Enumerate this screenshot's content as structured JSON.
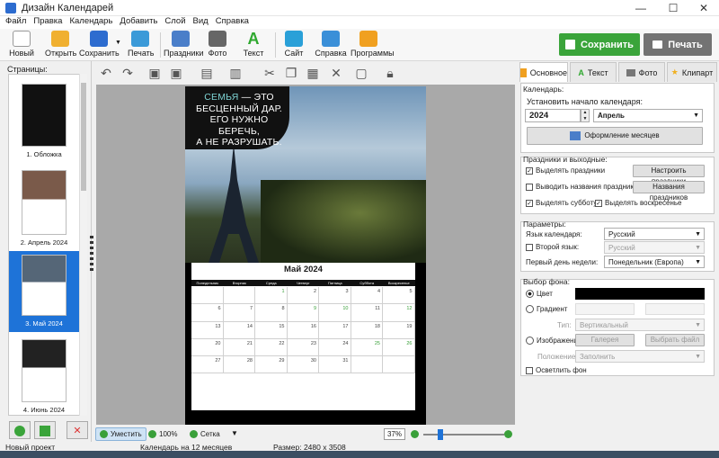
{
  "window": {
    "title": "Дизайн Календарей",
    "minimize": "—",
    "maximize": "☐",
    "close": "✕"
  },
  "menu": [
    "Файл",
    "Правка",
    "Календарь",
    "Добавить",
    "Слой",
    "Вид",
    "Справка"
  ],
  "toolbar": {
    "new": "Новый",
    "open": "Открыть",
    "save": "Сохранить",
    "print": "Печать",
    "holidays": "Праздники",
    "photo": "Фото",
    "text": "Текст",
    "site": "Сайт",
    "help": "Справка",
    "programs": "Программы",
    "save_big": "Сохранить",
    "print_big": "Печать",
    "colors": {
      "save_big": "#3aa43a",
      "print_big": "#737373"
    }
  },
  "left": {
    "header": "Страницы:",
    "thumbs": [
      {
        "label": "1. Обложка"
      },
      {
        "label": "2. Апрель 2024"
      },
      {
        "label": "3. Май 2024",
        "selected": true
      },
      {
        "label": "4. Июнь 2024"
      }
    ]
  },
  "page": {
    "quote_highlight": "СЕМЬЯ",
    "quote_line1": " — ЭТО",
    "quote_line2": "БЕСЦЕННЫЙ ДАР.",
    "quote_line3": "ЕГО НУЖНО БЕРЕЧЬ,",
    "quote_line4": "А НЕ РАЗРУШАТЬ.",
    "month_title": "Май 2024",
    "weekdays": [
      "Понедельник",
      "Вторник",
      "Среда",
      "Четверг",
      "Пятница",
      "Суббота",
      "Воскресенье"
    ],
    "weeks": [
      [
        "",
        "",
        "1",
        "2",
        "3",
        "4",
        "5"
      ],
      [
        "6",
        "7",
        "8",
        "9",
        "10",
        "11",
        "12"
      ],
      [
        "13",
        "14",
        "15",
        "16",
        "17",
        "18",
        "19"
      ],
      [
        "20",
        "21",
        "22",
        "23",
        "24",
        "25",
        "26"
      ],
      [
        "27",
        "28",
        "29",
        "30",
        "31",
        "",
        ""
      ]
    ],
    "green_days": [
      "1",
      "9",
      "10",
      "12",
      "25",
      "26"
    ]
  },
  "bottom": {
    "fit": "Уместить",
    "zoom100": "100%",
    "grid": "Сетка",
    "zoom": "37%"
  },
  "right": {
    "tabs": [
      "Основное",
      "Текст",
      "Фото",
      "Клипарт"
    ],
    "calendar_group": "Календарь:",
    "start_label": "Установить начало календаря:",
    "year": "2024",
    "month": "Апрель",
    "months_design": "Оформление месяцев",
    "holidays_group": "Праздники и выходные:",
    "highlight_holidays": "Выделять праздники",
    "setup_holidays": "Настроить праздники",
    "show_names": "Выводить названия праздников",
    "holiday_names": "Названия праздников",
    "highlight_sat": "Выделять субботу",
    "highlight_sun": "Выделять воскресенье",
    "params_group": "Параметры:",
    "lang_label": "Язык календаря:",
    "lang": "Русский",
    "lang2_label": "Второй язык:",
    "lang2": "Русский",
    "firstday_label": "Первый день недели:",
    "firstday": "Понедельник (Европа)",
    "bg_group": "Выбор фона:",
    "color_label": "Цвет",
    "gradient_label": "Градиент",
    "type_label": "Тип:",
    "type_value": "Вертикальный",
    "image_label": "Изображение",
    "gallery": "Галерея",
    "choose_file": "Выбрать файл",
    "position_label": "Положение:",
    "position_value": "Заполнить",
    "lighten": "Осветлить фон",
    "bg_color": "#000000"
  },
  "status": {
    "project": "Новый проект",
    "calendar": "Календарь на 12 месяцев",
    "size": "Размер: 2480 x 3508"
  }
}
